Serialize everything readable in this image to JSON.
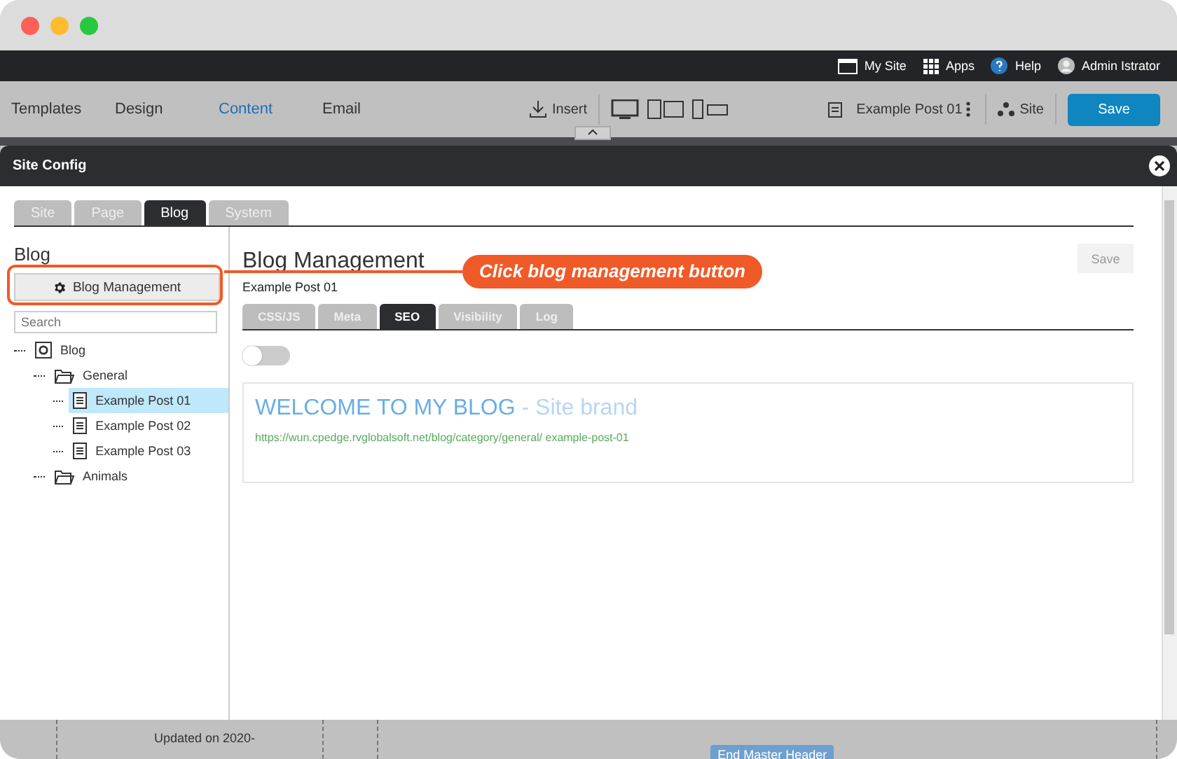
{
  "topbar": {
    "links": [
      {
        "kind": "site",
        "label": "My Site"
      },
      {
        "kind": "apps",
        "label": "Apps"
      },
      {
        "kind": "help",
        "label": "Help"
      },
      {
        "kind": "user",
        "label": "Admin Istrator"
      }
    ]
  },
  "toolbar": {
    "tabs": [
      {
        "label": "Templates",
        "selected": false
      },
      {
        "label": "Design",
        "selected": false
      },
      {
        "label": "Content",
        "selected": true
      },
      {
        "label": "Email",
        "selected": false
      }
    ],
    "insert": "Insert",
    "page": "Example Post 01",
    "site": "Site",
    "save": "Save"
  },
  "modal": {
    "title": "Site Config",
    "tabs": [
      {
        "label": "Site",
        "selected": false
      },
      {
        "label": "Page",
        "selected": false
      },
      {
        "label": "Blog",
        "selected": true
      },
      {
        "label": "System",
        "selected": false
      }
    ],
    "sidebar": {
      "heading": "Blog",
      "button": "Blog Management",
      "search": {
        "placeholder": "Search"
      },
      "tree": [
        {
          "kind": "root",
          "label": "Blog",
          "selected": false,
          "children": [
            {
              "kind": "folder",
              "label": "General",
              "selected": false,
              "children": [
                {
                  "kind": "post",
                  "label": "Example Post 01",
                  "selected": true
                },
                {
                  "kind": "post",
                  "label": "Example Post 02",
                  "selected": false
                },
                {
                  "kind": "post",
                  "label": "Example Post 03",
                  "selected": false
                }
              ]
            },
            {
              "kind": "folder",
              "label": "Animals",
              "selected": false
            }
          ]
        }
      ]
    },
    "main": {
      "title": "Blog Management",
      "save": "Save",
      "subtitle": "Example Post 01",
      "tabs": [
        {
          "label": "CSS/JS",
          "selected": false
        },
        {
          "label": "Meta",
          "selected": false
        },
        {
          "label": "SEO",
          "selected": true
        },
        {
          "label": "Visibility",
          "selected": false
        },
        {
          "label": "Log",
          "selected": false
        }
      ],
      "toggle": {
        "on": false
      },
      "preview": {
        "title": "WELCOME TO MY BLOG",
        "brand": "- Site brand",
        "url": "https://wun.cpedge.rvglobalsoft.net/blog/category/general/ example-post-01"
      }
    }
  },
  "callout": "Click blog management button",
  "background": {
    "updated": "Updated on 2020-",
    "badge": "End Master Header"
  }
}
